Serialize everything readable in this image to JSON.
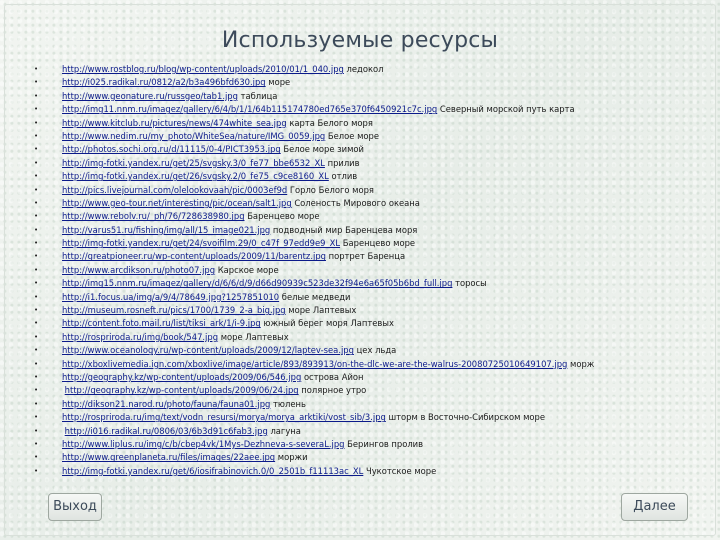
{
  "title": "Используемые ресурсы",
  "bullet_glyph": "•",
  "resources": [
    {
      "url": "http://www.rostblog.ru/blog/wp-content/uploads/2010/01/1_040.jpg",
      "desc": "ледокол"
    },
    {
      "url": "http://i025.radikal.ru/0812/a2/b3a496bfd630.jpg",
      "desc": "море"
    },
    {
      "url": "http://www.geonature.ru/russgeo/tab1.jpg",
      "desc": "таблица"
    },
    {
      "url": "http://img11.nnm.ru/imagez/gallery/6/4/b/1/1/64b115174780ed765e370f6450921c7c.jpg",
      "desc": "Северный морской путь карта"
    },
    {
      "url": "http://www.kitclub.ru/pictures/news/474white_sea.jpg",
      "desc": "карта Белого моря"
    },
    {
      "url": "http://www.nedim.ru/my_photo/WhiteSea/nature/IMG_0059.jpg",
      "desc": "Белое море"
    },
    {
      "url": "http://photos.sochi.org.ru/d/11115/0-4/PICT3953.jpg",
      "desc": "Белое море зимой"
    },
    {
      "url": "http://img-fotki.yandex.ru/get/25/svgsky.3/0_fe77_bbe6532_XL",
      "desc": "прилив"
    },
    {
      "url": "http://img-fotki.yandex.ru/get/26/svgsky.2/0_fe75_c9ce8160_XL",
      "desc": "отлив"
    },
    {
      "url": "http://pics.livejournal.com/olelookovaah/pic/0003ef9d",
      "desc": "Горло Белого моря"
    },
    {
      "url": "http://www.geo-tour.net/interesting/pic/ocean/salt1.jpg",
      "desc": "Соленость Мирового океана"
    },
    {
      "url": "http://www.rebolv.ru/_ph/76/728638980.jpg",
      "desc": "Баренцево море"
    },
    {
      "url": "http://varus51.ru/fishing/img/all/15_image021.jpg",
      "desc": "подводный мир Баренцева моря"
    },
    {
      "url": "http://img-fotki.yandex.ru/get/24/svoifilm.29/0_c47f_97edd9e9_XL",
      "desc": "Баренцево море"
    },
    {
      "url": "http://greatpioneer.ru/wp-content/uploads/2009/11/barentz.jpg",
      "desc": "портрет Баренца"
    },
    {
      "url": "http://www.arcdikson.ru/photo07.jpg",
      "desc": "Карское море"
    },
    {
      "url": "http://img15.nnm.ru/imagez/gallery/d/6/6/d/9/d66d90939c523de32f94e6a65f05b6bd_full.jpg",
      "desc": "торосы"
    },
    {
      "url": "http://i1.focus.ua/img/a/9/4/78649.jpg?1257851010",
      "desc": "белые медведи"
    },
    {
      "url": "http://museum.rosneft.ru/pics/1700/1739_2-a_big.jpg",
      "desc": "море Лаптевых"
    },
    {
      "url": "http://content.foto.mail.ru/list/tiksi_ark/1/i-9.jpg",
      "desc": "южный берег моря Лаптевых"
    },
    {
      "url": "http://rospriroda.ru/img/book/547.jpg",
      "desc": "море Лаптевых"
    },
    {
      "url": "http://www.oceanology.ru/wp-content/uploads/2009/12/laptev-sea.jpg",
      "desc": "цех льда"
    },
    {
      "url": "http://xboxlivemedia.ign.com/xboxlive/image/article/893/893913/on-the-dlc-we-are-the-walrus-20080725010649107.jpg",
      "desc": "морж"
    },
    {
      "url": "http://geography.kz/wp-content/uploads/2009/06/546.jpg",
      "desc": "острова Айон"
    },
    {
      "url": "http://geography.kz/wp-content/uploads/2009/06/24.jpg",
      "desc": "полярное утро",
      "lead": " "
    },
    {
      "url": "http://dikson21.narod.ru/photo/fauna/fauna01.jpg",
      "desc": "тюлень"
    },
    {
      "url": "http://rospriroda.ru/img/text/vodn_resursi/morya/morya_arktiki/vost_sib/3.jpg",
      "desc": "шторм в Восточно-Сибирском море"
    },
    {
      "url": "http://i016.radikal.ru/0806/03/6b3d91c6fab3.jpg",
      "desc": "лагуна",
      "lead": " "
    },
    {
      "url": "http://www.liplus.ru/img/c/b/cbep4vk/1Mys-Dezhneva-s-severaL.jpg",
      "desc": "Берингов пролив"
    },
    {
      "url": "http://www.greenplaneta.ru/files/images/22aee.jpg",
      "desc": "моржи"
    },
    {
      "url": "http://img-fotki.yandex.ru/get/6/iosifrabinovich.0/0_2501b_f11113ac_XL",
      "desc": "Чукотское море"
    }
  ],
  "buttons": {
    "exit_label": "Выход",
    "next_label": "Далее"
  },
  "colors": {
    "title": "#3c4a5a",
    "link": "#0b1a8a",
    "background": "#eef2ee"
  }
}
